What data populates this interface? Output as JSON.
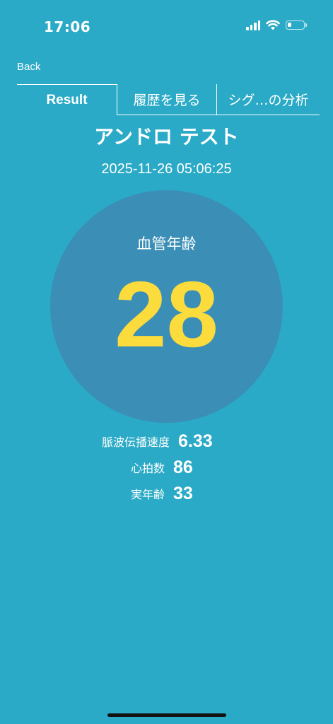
{
  "status_bar": {
    "time": "17:06",
    "battery_level": 0.25
  },
  "nav": {
    "back_label": "Back"
  },
  "tabs": [
    {
      "label": "Result",
      "selected": true
    },
    {
      "label": "履歴を見る",
      "selected": false
    },
    {
      "label": "シグ…の分析",
      "selected": false
    }
  ],
  "test": {
    "name": "アンドロ テスト",
    "timestamp": "2025-11-26 05:06:25"
  },
  "vascular_age": {
    "label": "血管年齢",
    "value": "28"
  },
  "metrics": [
    {
      "label": "脈波伝播速度",
      "value": "6.33"
    },
    {
      "label": "心拍数",
      "value": "86"
    },
    {
      "label": "実年齢",
      "value": "33"
    }
  ],
  "colors": {
    "background": "#2aaac6",
    "circle": "#3b8fb6",
    "highlight": "#fbdc3c",
    "text": "#ffffff"
  }
}
